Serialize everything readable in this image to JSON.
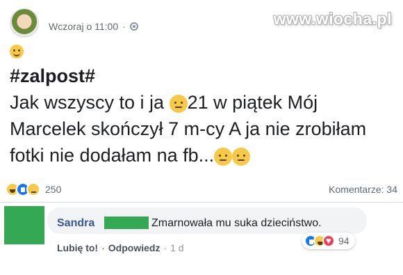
{
  "header": {
    "timestamp": "Wczoraj o 11:00",
    "privacy_icon": "globe-icon"
  },
  "watermark": "www.wiocha.pl",
  "post": {
    "hashtag": "#zalpost#",
    "line1_before": "Jak wszyscy to i ja",
    "line1_after": "21 w piątek Mój",
    "line2": "Marcelek skończył 7 m-cy A ja nie zrobiłam",
    "line3": "fotki nie dodałam na fb...",
    "emojis": [
      "smile-emoji",
      "sad-emoji",
      "sad-emoji"
    ]
  },
  "reactions": {
    "icons": [
      "haha-reaction-icon",
      "like-reaction-icon",
      "sad-reaction-icon"
    ],
    "count": "250"
  },
  "comments_count": "Komentarze: 34",
  "comment": {
    "author": "Sandra",
    "text": "Zmarnowała mu suka dzieciństwo.",
    "like_label": "Lubię to!",
    "reply_label": "Odpowiedz",
    "time": "1 d",
    "reaction_icons": [
      "like-reaction-icon",
      "haha-reaction-icon",
      "love-reaction-icon"
    ],
    "reaction_count": "94"
  },
  "colors": {
    "author_link": "#385898",
    "like_blue": "#1877f2",
    "censor_green": "#34a853",
    "bubble_bg": "#f2f3f5"
  }
}
